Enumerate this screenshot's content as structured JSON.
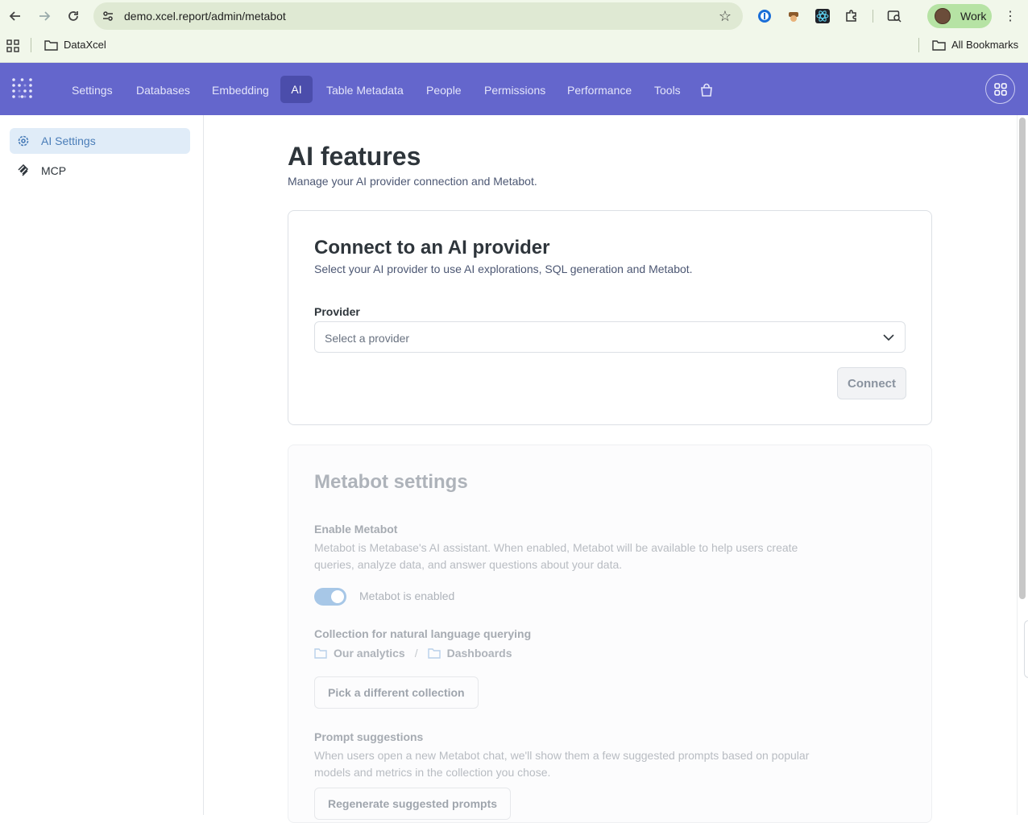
{
  "browser": {
    "url": "demo.xcel.report/admin/metabot",
    "profile_name": "Work",
    "bookmarks": [
      "DataXcel"
    ],
    "all_bookmarks_label": "All Bookmarks"
  },
  "header": {
    "nav": [
      "Settings",
      "Databases",
      "Embedding",
      "AI",
      "Table Metadata",
      "People",
      "Permissions",
      "Performance",
      "Tools"
    ],
    "active_tab": "AI",
    "accent_color": "#6466cc"
  },
  "sidebar": {
    "items": [
      {
        "label": "AI Settings",
        "icon": "gear-icon",
        "active": true
      },
      {
        "label": "MCP",
        "icon": "mcp-icon",
        "active": false
      }
    ]
  },
  "main": {
    "title": "AI features",
    "subtitle": "Manage your AI provider connection and Metabot.",
    "provider_card": {
      "title": "Connect to an AI provider",
      "description": "Select your AI provider to use AI explorations, SQL generation and Metabot.",
      "provider_label": "Provider",
      "provider_placeholder": "Select a provider",
      "connect_label": "Connect"
    },
    "metabot_card": {
      "title": "Metabot settings",
      "enable_label": "Enable Metabot",
      "enable_desc": "Metabot is Metabase's AI assistant. When enabled, Metabot will be available to help users create queries, analyze data, and answer questions about your data.",
      "toggle_label": "Metabot is enabled",
      "toggle_on": true,
      "collection_label": "Collection for natural language querying",
      "collection_path": [
        "Our analytics",
        "Dashboards"
      ],
      "pick_collection_label": "Pick a different collection",
      "prompt_label": "Prompt suggestions",
      "prompt_desc": "When users open a new Metabot chat, we'll show them a few suggested prompts based on popular models and metrics in the collection you chose.",
      "regenerate_label": "Regenerate suggested prompts"
    }
  }
}
